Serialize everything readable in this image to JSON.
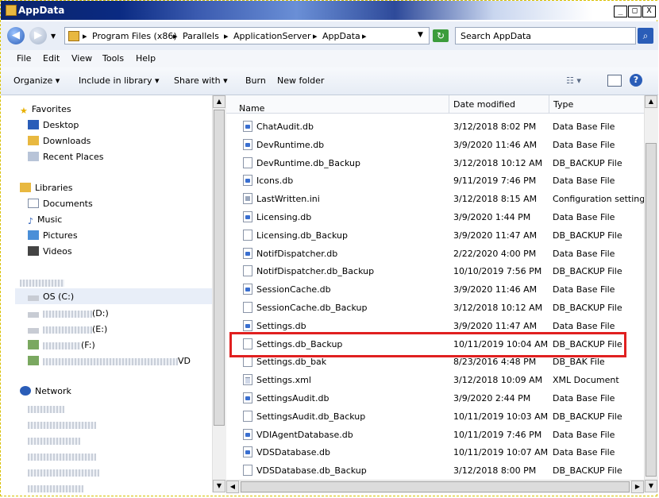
{
  "window": {
    "title": "AppData",
    "min": "_",
    "max": "□",
    "close": "X"
  },
  "address": {
    "crumbs": [
      "Program Files (x86)",
      "Parallels",
      "ApplicationServer",
      "AppData"
    ],
    "search_placeholder": "Search AppData"
  },
  "menu": [
    "File",
    "Edit",
    "View",
    "Tools",
    "Help"
  ],
  "commands": {
    "organize": "Organize",
    "include": "Include in library",
    "share": "Share with",
    "burn": "Burn",
    "new_folder": "New folder"
  },
  "nav": {
    "favorites": "Favorites",
    "fav_items": [
      "Desktop",
      "Downloads",
      "Recent Places"
    ],
    "libraries": "Libraries",
    "lib_items": [
      "Documents",
      "Music",
      "Pictures",
      "Videos"
    ],
    "drive_c": "OS (C:)",
    "drive_d": "(D:)",
    "drive_e": "(E:)",
    "drive_f": "(F:)",
    "drive_v": "VD",
    "network": "Network"
  },
  "columns": {
    "name": "Name",
    "date": "Date modified",
    "type": "Type"
  },
  "files": [
    {
      "name": "ChatAudit.db",
      "date": "3/12/2018 8:02 PM",
      "type": "Data Base File",
      "icon": "db"
    },
    {
      "name": "DevRuntime.db",
      "date": "3/9/2020 11:46 AM",
      "type": "Data Base File",
      "icon": "db"
    },
    {
      "name": "DevRuntime.db_Backup",
      "date": "3/12/2018 10:12 AM",
      "type": "DB_BACKUP File",
      "icon": "blank"
    },
    {
      "name": "Icons.db",
      "date": "9/11/2019 7:46 PM",
      "type": "Data Base File",
      "icon": "db"
    },
    {
      "name": "LastWritten.ini",
      "date": "3/12/2018 8:15 AM",
      "type": "Configuration settings",
      "icon": "ini"
    },
    {
      "name": "Licensing.db",
      "date": "3/9/2020 1:44 PM",
      "type": "Data Base File",
      "icon": "db"
    },
    {
      "name": "Licensing.db_Backup",
      "date": "3/9/2020 11:47 AM",
      "type": "DB_BACKUP File",
      "icon": "blank"
    },
    {
      "name": "NotifDispatcher.db",
      "date": "2/22/2020 4:00 PM",
      "type": "Data Base File",
      "icon": "db"
    },
    {
      "name": "NotifDispatcher.db_Backup",
      "date": "10/10/2019 7:56 PM",
      "type": "DB_BACKUP File",
      "icon": "blank"
    },
    {
      "name": "SessionCache.db",
      "date": "3/9/2020 11:46 AM",
      "type": "Data Base File",
      "icon": "db"
    },
    {
      "name": "SessionCache.db_Backup",
      "date": "3/12/2018 10:12 AM",
      "type": "DB_BACKUP File",
      "icon": "blank"
    },
    {
      "name": "Settings.db",
      "date": "3/9/2020 11:47 AM",
      "type": "Data Base File",
      "icon": "db"
    },
    {
      "name": "Settings.db_Backup",
      "date": "10/11/2019 10:04 AM",
      "type": "DB_BACKUP File",
      "icon": "blank"
    },
    {
      "name": "Settings.db_bak",
      "date": "8/23/2016 4:48 PM",
      "type": "DB_BAK File",
      "icon": "blank"
    },
    {
      "name": "Settings.xml",
      "date": "3/12/2018 10:09 AM",
      "type": "XML Document",
      "icon": "xml"
    },
    {
      "name": "SettingsAudit.db",
      "date": "3/9/2020 2:44 PM",
      "type": "Data Base File",
      "icon": "db"
    },
    {
      "name": "SettingsAudit.db_Backup",
      "date": "10/11/2019 10:03 AM",
      "type": "DB_BACKUP File",
      "icon": "blank"
    },
    {
      "name": "VDIAgentDatabase.db",
      "date": "10/11/2019 7:46 PM",
      "type": "Data Base File",
      "icon": "db"
    },
    {
      "name": "VDSDatabase.db",
      "date": "10/11/2019 10:07 AM",
      "type": "Data Base File",
      "icon": "db"
    },
    {
      "name": "VDSDatabase.db_Backup",
      "date": "3/12/2018 8:00 PM",
      "type": "DB_BACKUP File",
      "icon": "blank"
    }
  ]
}
